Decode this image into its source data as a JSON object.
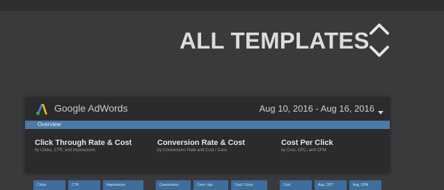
{
  "banner": {
    "title": "ALL TEMPLATES"
  },
  "nav": {
    "up_icon": "chevron-up-icon",
    "down_icon": "chevron-down-icon",
    "color": "#e6e6e6"
  },
  "preview": {
    "app_name": "Google AdWords",
    "logo_icon": "google-adwords-logo",
    "date_range": "Aug 10, 2016 - Aug 16, 2016",
    "tab": "Overview",
    "accent": "#4a7aa9",
    "sections": [
      {
        "title": "Click Through Rate & Cost",
        "subtitle": "by Clicks, CTR, and Impressions",
        "metrics": [
          "Clicks",
          "CTR",
          "Impressions"
        ]
      },
      {
        "title": "Conversion Rate & Cost",
        "subtitle": "by Conversions Rate and Cost / Conv",
        "metrics": [
          "Conversions",
          "Conv. rate",
          "Cost / Conv."
        ]
      },
      {
        "title": "Cost Per Click",
        "subtitle": "by Cost, CPC, and CPM",
        "metrics": [
          "Cost",
          "Avg. CPC",
          "Avg. CPM"
        ]
      }
    ]
  }
}
